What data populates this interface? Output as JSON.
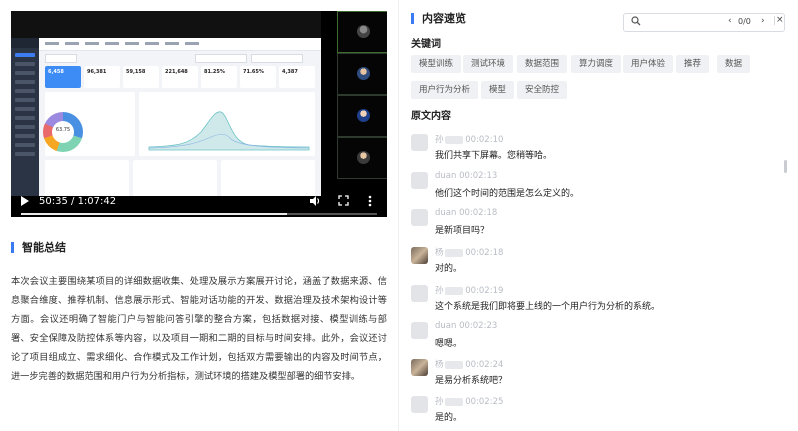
{
  "video": {
    "current_time": "50:35",
    "duration": "1:07:42",
    "time_sep": " / ",
    "progress_fraction": 0.747,
    "kpi_values": [
      "6,458",
      "96,381",
      "59,158",
      "221,648",
      "81.25%",
      "71.65%",
      "4,387"
    ],
    "ring_value": "63.75",
    "icons": {
      "play": "play-icon",
      "volume": "volume-icon",
      "fullscreen": "fullscreen-icon",
      "more": "more-vertical-icon"
    }
  },
  "summary": {
    "title": "智能总结",
    "text": "本次会议主要围绕某项目的详细数据收集、处理及展示方案展开讨论，涵盖了数据来源、信息聚合维度、推荐机制、信息展示形式、智能对话功能的开发、数据治理及技术架构设计等方面。会议还明确了智能门户与智能问答引擎的整合方案，包括数据对接、模型训练与部署、安全保障及防控体系等内容，以及项目一期和二期的目标与时间安排。此外，会议还讨论了项目组成立、需求细化、合作模式及工作计划，包括双方需要输出的内容及时间节点，进一步完善的数据范围和用户行为分析指标，测试环境的搭建及模型部署的细节安排。"
  },
  "overview": {
    "title": "内容速览",
    "search": {
      "placeholder": "",
      "count": "0/0",
      "prev": "‹",
      "next": "›",
      "close": "×"
    },
    "keywords_title": "关键词",
    "keywords": [
      "模型训练",
      "测试环境",
      "数据范围",
      "算力调度",
      "用户体验",
      "推荐",
      "数据",
      "用户行为分析",
      "模型",
      "安全防控"
    ],
    "transcript_title": "原文内容",
    "messages": [
      {
        "name": "孙",
        "time": "00:02:10",
        "text": "我们共享下屏幕。您稍等哈。",
        "avatar": "placeholder"
      },
      {
        "name": "duan",
        "time": "00:02:13",
        "text": "他们这个时间的范围是怎么定义的。",
        "avatar": "placeholder"
      },
      {
        "name": "duan",
        "time": "00:02:18",
        "text": "是新项目吗？",
        "avatar": "placeholder"
      },
      {
        "name": "杨",
        "time": "00:02:18",
        "text": "对的。",
        "avatar": "photo"
      },
      {
        "name": "孙",
        "time": "00:02:19",
        "text": "这个系统是我们即将要上线的一个用户行为分析的系统。",
        "avatar": "placeholder"
      },
      {
        "name": "duan",
        "time": "00:02:23",
        "text": "嗯嗯。",
        "avatar": "placeholder"
      },
      {
        "name": "杨",
        "time": "00:02:24",
        "text": "是易分析系统吧？",
        "avatar": "photo"
      },
      {
        "name": "孙",
        "time": "00:02:25",
        "text": "是的。",
        "avatar": "placeholder"
      }
    ]
  }
}
